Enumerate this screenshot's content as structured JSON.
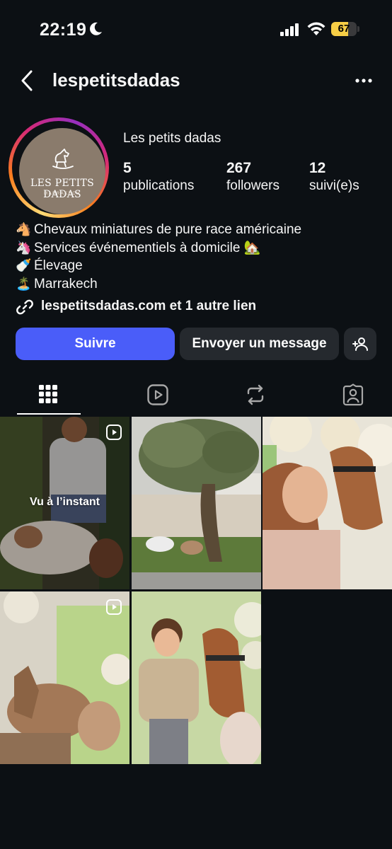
{
  "status_bar": {
    "time": "22:19",
    "battery": "67",
    "battery_level": 0.67
  },
  "header": {
    "username": "lespetitsdadas"
  },
  "profile": {
    "avatar_title": "LES PETITS DADAS",
    "avatar_subtitle": "MARRAKECH",
    "display_name": "Les petits dadas",
    "stats": [
      {
        "value": "5",
        "label": "publications"
      },
      {
        "value": "267",
        "label": "followers"
      },
      {
        "value": "12",
        "label": "suivi(e)s"
      }
    ],
    "bio": [
      {
        "emoji": "🐴",
        "text": "Chevaux miniatures de pure race américaine"
      },
      {
        "emoji": "🦄",
        "text": "Services événementiels à domicile 🏡"
      },
      {
        "emoji": "🍼",
        "text": "Élevage"
      },
      {
        "emoji": "🏝️",
        "text": "Marrakech"
      }
    ],
    "link": "lespetitsdadas.com et 1 autre lien"
  },
  "actions": {
    "follow": "Suivre",
    "message": "Envoyer un message"
  },
  "tabs": [
    {
      "icon": "grid-icon",
      "active": true
    },
    {
      "icon": "reels-icon",
      "active": false
    },
    {
      "icon": "reposts-icon",
      "active": false
    },
    {
      "icon": "tagged-icon",
      "active": false
    }
  ],
  "posts": [
    {
      "overlay": "Vu à l’instant",
      "reel": true
    },
    {
      "overlay": "",
      "reel": false
    },
    {
      "overlay": "",
      "reel": false
    },
    {
      "overlay": "",
      "reel": true
    },
    {
      "overlay": "",
      "reel": false
    }
  ],
  "colors": {
    "background": "#0c1014",
    "follow_button": "#4a5df9",
    "secondary_button": "#25292e",
    "battery": "#f7ce46"
  }
}
